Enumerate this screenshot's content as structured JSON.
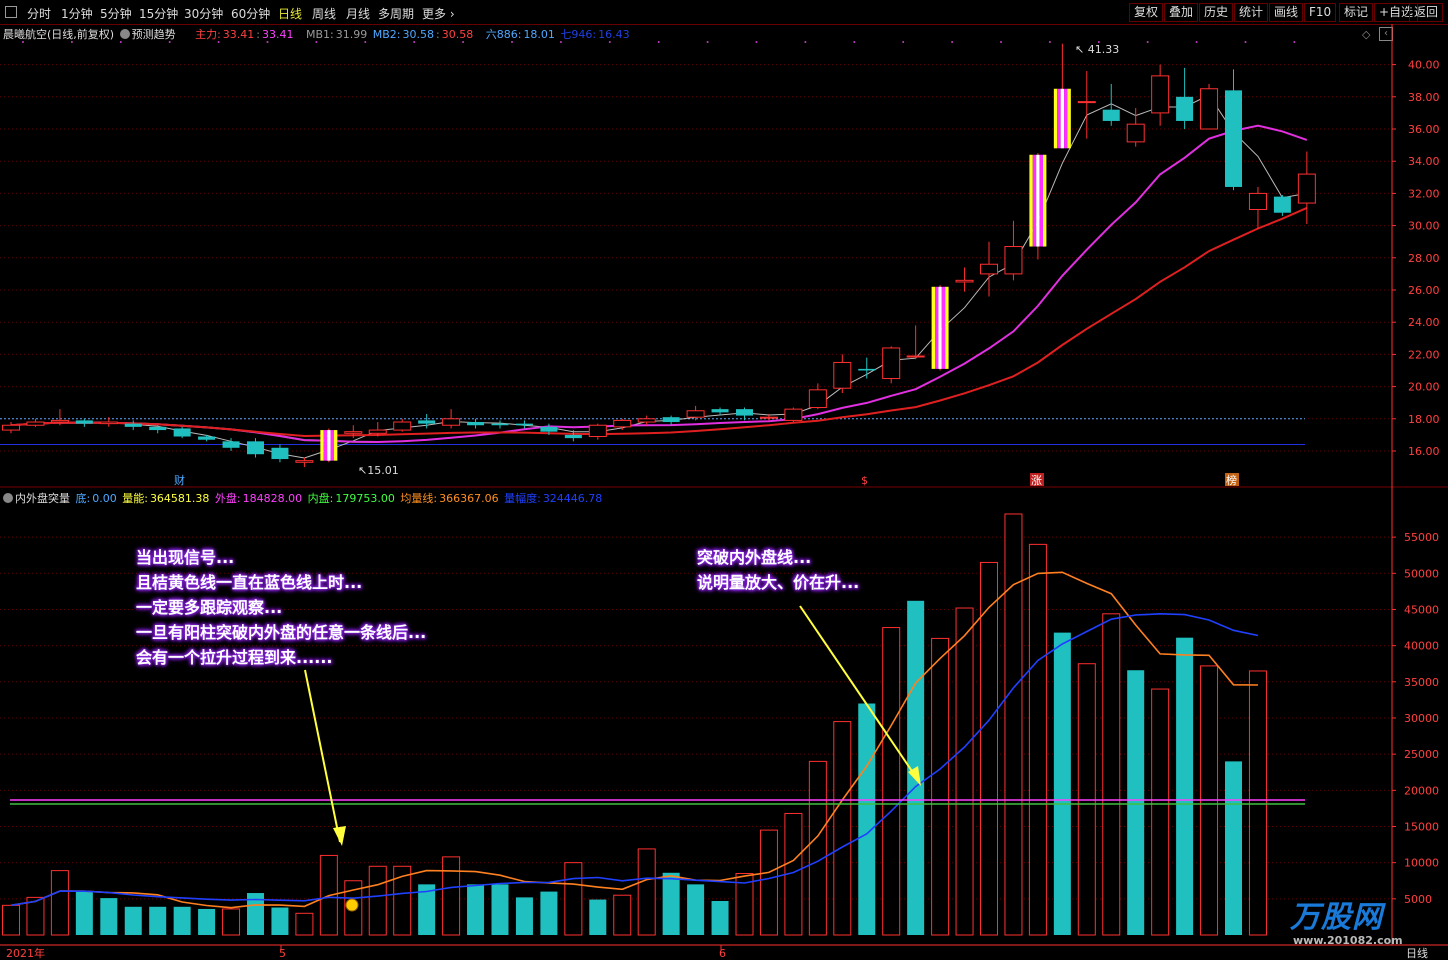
{
  "toolbar": {
    "tabs": [
      {
        "label": "分时",
        "active": false
      },
      {
        "label": "1分钟",
        "active": false
      },
      {
        "label": "5分钟",
        "active": false
      },
      {
        "label": "15分钟",
        "active": false
      },
      {
        "label": "30分钟",
        "active": false
      },
      {
        "label": "60分钟",
        "active": false
      },
      {
        "label": "日线",
        "active": true
      },
      {
        "label": "周线",
        "active": false
      },
      {
        "label": "月线",
        "active": false
      },
      {
        "label": "多周期",
        "active": false
      },
      {
        "label": "更多",
        "active": false
      }
    ],
    "buttons": [
      "复权",
      "叠加",
      "历史",
      "统计",
      "画线",
      "F10",
      "标记",
      "+自选",
      "返回"
    ]
  },
  "main_legend": {
    "stock_name": "晨曦航空(日线,前复权)",
    "forecast": "预测趋势",
    "main_label": "主力:",
    "main_value": "33.41",
    "main_value2": "33.41",
    "mb1_label": "MB1:",
    "mb1_value": "31.99",
    "mb2_label": "MB2:",
    "mb2_value": "30.58",
    "mb2_value2": "30.58",
    "six_label": "六886:",
    "six_value": "18.01",
    "seven_label": "七946:",
    "seven_value": "16.43"
  },
  "lower_legend": {
    "name": "内外盘突量",
    "di_label": "底:",
    "di_value": "0.00",
    "lianeng_label": "量能:",
    "lianeng_value": "364581.38",
    "waipan_label": "外盘:",
    "waipan_value": "184828.00",
    "neipan_label": "内盘:",
    "neipan_value": "179753.00",
    "junliang_label": "均量线:",
    "junliang_value": "366367.06",
    "liangfu_label": "量幅度:",
    "liangfu_value": "324446.78"
  },
  "callout_left": [
    "当出现信号...",
    "且桔黄色线一直在蓝色线上时...",
    "一定要多跟踪观察...",
    "一旦有阳柱突破内外盘的任意一条线后...",
    "会有一个拉升过程到来......"
  ],
  "callout_right": [
    "突破内外盘线...",
    "说明量放大、价在升..."
  ],
  "markers": {
    "cai": "财",
    "dollar": "$",
    "zhang": "涨",
    "bang": "榜"
  },
  "annotations": {
    "high": "41.33",
    "low": "15.01"
  },
  "xaxis": {
    "year": "2021年",
    "m5": "5",
    "m6": "6",
    "period": "日线"
  },
  "watermark": {
    "brand": "万股网",
    "url": "www.201082.com"
  },
  "colors": {
    "up": "#ff3030",
    "down": "#20c0c0",
    "grid": "#600000",
    "axis": "#ff3030"
  },
  "chart_data": {
    "type": "candlestick",
    "price_axis": {
      "ticks": [
        16,
        18,
        20,
        22,
        24,
        26,
        28,
        30,
        32,
        34,
        36,
        38,
        40
      ]
    },
    "volume_axis": {
      "ticks": [
        5000,
        10000,
        15000,
        20000,
        25000,
        30000,
        35000,
        40000,
        45000,
        50000,
        55000
      ]
    },
    "candles": [
      {
        "o": 17.3,
        "c": 17.6,
        "h": 17.8,
        "l": 17.1
      },
      {
        "o": 17.6,
        "c": 17.8,
        "h": 18.0,
        "l": 17.5
      },
      {
        "o": 17.8,
        "c": 17.9,
        "h": 18.6,
        "l": 17.6
      },
      {
        "o": 17.9,
        "c": 17.7,
        "h": 18.0,
        "l": 17.5
      },
      {
        "o": 17.7,
        "c": 17.8,
        "h": 18.1,
        "l": 17.5
      },
      {
        "o": 17.7,
        "c": 17.5,
        "h": 17.9,
        "l": 17.3
      },
      {
        "o": 17.5,
        "c": 17.3,
        "h": 17.6,
        "l": 17.1
      },
      {
        "o": 17.4,
        "c": 16.9,
        "h": 17.5,
        "l": 16.8
      },
      {
        "o": 16.9,
        "c": 16.7,
        "h": 17.0,
        "l": 16.6
      },
      {
        "o": 16.6,
        "c": 16.2,
        "h": 16.8,
        "l": 16.0
      },
      {
        "o": 16.6,
        "c": 15.8,
        "h": 16.8,
        "l": 15.6
      },
      {
        "o": 16.2,
        "c": 15.5,
        "h": 16.4,
        "l": 15.3
      },
      {
        "o": 15.3,
        "c": 15.4,
        "h": 15.6,
        "l": 15.0
      },
      {
        "o": 15.4,
        "c": 17.3,
        "h": 17.4,
        "l": 15.3,
        "sig": true
      },
      {
        "o": 17.1,
        "c": 17.2,
        "h": 17.6,
        "l": 16.8
      },
      {
        "o": 17.1,
        "c": 17.3,
        "h": 17.8,
        "l": 16.9
      },
      {
        "o": 17.3,
        "c": 17.8,
        "h": 18.0,
        "l": 17.2
      },
      {
        "o": 17.9,
        "c": 17.7,
        "h": 18.3,
        "l": 17.4
      },
      {
        "o": 17.6,
        "c": 18.0,
        "h": 18.6,
        "l": 17.4
      },
      {
        "o": 17.8,
        "c": 17.6,
        "h": 18.0,
        "l": 17.4
      },
      {
        "o": 17.7,
        "c": 17.6,
        "h": 17.9,
        "l": 17.4
      },
      {
        "o": 17.7,
        "c": 17.6,
        "h": 17.9,
        "l": 17.4
      },
      {
        "o": 17.5,
        "c": 17.2,
        "h": 17.7,
        "l": 17.0
      },
      {
        "o": 17.0,
        "c": 16.8,
        "h": 17.3,
        "l": 16.6
      },
      {
        "o": 16.9,
        "c": 17.6,
        "h": 17.7,
        "l": 16.7
      },
      {
        "o": 17.5,
        "c": 17.9,
        "h": 18.0,
        "l": 17.3
      },
      {
        "o": 17.8,
        "c": 18.0,
        "h": 18.2,
        "l": 17.6
      },
      {
        "o": 18.1,
        "c": 17.8,
        "h": 18.2,
        "l": 17.6
      },
      {
        "o": 18.1,
        "c": 18.5,
        "h": 18.8,
        "l": 17.9
      },
      {
        "o": 18.6,
        "c": 18.4,
        "h": 18.7,
        "l": 18.2
      },
      {
        "o": 18.6,
        "c": 18.2,
        "h": 18.7,
        "l": 17.9
      },
      {
        "o": 18.1,
        "c": 18.1,
        "h": 18.3,
        "l": 17.9
      },
      {
        "o": 17.9,
        "c": 18.6,
        "h": 18.7,
        "l": 17.8
      },
      {
        "o": 18.7,
        "c": 19.8,
        "h": 20.2,
        "l": 18.6
      },
      {
        "o": 19.9,
        "c": 21.5,
        "h": 22.0,
        "l": 19.6
      },
      {
        "o": 21.1,
        "c": 21.0,
        "h": 21.8,
        "l": 20.5
      },
      {
        "o": 20.5,
        "c": 22.4,
        "h": 22.5,
        "l": 20.2
      },
      {
        "o": 21.9,
        "c": 21.9,
        "h": 23.8,
        "l": 21.7
      },
      {
        "o": 21.1,
        "c": 26.2,
        "h": 26.3,
        "l": 21.0,
        "sig": true
      },
      {
        "o": 26.5,
        "c": 26.6,
        "h": 27.4,
        "l": 25.9
      },
      {
        "o": 27.0,
        "c": 27.6,
        "h": 29.0,
        "l": 25.6
      },
      {
        "o": 27.0,
        "c": 28.7,
        "h": 30.3,
        "l": 26.6
      },
      {
        "o": 28.7,
        "c": 34.4,
        "h": 34.5,
        "l": 27.9,
        "sig": true
      },
      {
        "o": 34.8,
        "c": 38.5,
        "h": 41.3,
        "l": 34.8,
        "sig": true
      },
      {
        "o": 37.7,
        "c": 37.7,
        "h": 39.6,
        "l": 35.4
      },
      {
        "o": 37.2,
        "c": 36.5,
        "h": 38.8,
        "l": 36.2
      },
      {
        "o": 35.2,
        "c": 36.3,
        "h": 37.3,
        "l": 34.9
      },
      {
        "o": 37.0,
        "c": 39.3,
        "h": 40.0,
        "l": 36.2
      },
      {
        "o": 38.0,
        "c": 36.5,
        "h": 39.8,
        "l": 36.0
      },
      {
        "o": 36.0,
        "c": 38.5,
        "h": 38.8,
        "l": 36.0
      },
      {
        "o": 38.4,
        "c": 32.4,
        "h": 39.7,
        "l": 32.2
      },
      {
        "o": 31.0,
        "c": 32.0,
        "h": 32.4,
        "l": 29.8
      },
      {
        "o": 31.8,
        "c": 30.8,
        "h": 31.9,
        "l": 30.6
      },
      {
        "o": 31.4,
        "c": 33.2,
        "h": 34.6,
        "l": 30.1
      }
    ],
    "volume": [
      {
        "v": 4100,
        "up": true
      },
      {
        "v": 5200,
        "up": true
      },
      {
        "v": 8900,
        "up": true
      },
      {
        "v": 6000,
        "up": false
      },
      {
        "v": 5100,
        "up": false
      },
      {
        "v": 3900,
        "up": false
      },
      {
        "v": 3900,
        "up": false
      },
      {
        "v": 3900,
        "up": false
      },
      {
        "v": 3600,
        "up": false
      },
      {
        "v": 3600,
        "up": true
      },
      {
        "v": 5800,
        "up": false
      },
      {
        "v": 3800,
        "up": false
      },
      {
        "v": 3000,
        "up": true
      },
      {
        "v": 11000,
        "up": true
      },
      {
        "v": 7500,
        "up": true
      },
      {
        "v": 9500,
        "up": true
      },
      {
        "v": 9500,
        "up": true
      },
      {
        "v": 7000,
        "up": false
      },
      {
        "v": 10800,
        "up": true
      },
      {
        "v": 7000,
        "up": false
      },
      {
        "v": 7000,
        "up": false
      },
      {
        "v": 5200,
        "up": false
      },
      {
        "v": 6000,
        "up": false
      },
      {
        "v": 10000,
        "up": true
      },
      {
        "v": 4900,
        "up": false
      },
      {
        "v": 5500,
        "up": true
      },
      {
        "v": 11900,
        "up": true
      },
      {
        "v": 8600,
        "up": false
      },
      {
        "v": 7000,
        "up": false
      },
      {
        "v": 4700,
        "up": false
      },
      {
        "v": 8500,
        "up": true
      },
      {
        "v": 14500,
        "up": true
      },
      {
        "v": 16800,
        "up": true
      },
      {
        "v": 24000,
        "up": true
      },
      {
        "v": 29500,
        "up": true
      },
      {
        "v": 32000,
        "up": false
      },
      {
        "v": 42500,
        "up": true
      },
      {
        "v": 46200,
        "up": false
      },
      {
        "v": 41000,
        "up": true
      },
      {
        "v": 45200,
        "up": true
      },
      {
        "v": 51500,
        "up": true
      },
      {
        "v": 58200,
        "up": true
      },
      {
        "v": 54000,
        "up": true
      },
      {
        "v": 41800,
        "up": false
      },
      {
        "v": 37500,
        "up": true
      },
      {
        "v": 44400,
        "up": true
      },
      {
        "v": 36600,
        "up": false
      },
      {
        "v": 34000,
        "up": true
      },
      {
        "v": 41100,
        "up": false
      },
      {
        "v": 37200,
        "up": true
      },
      {
        "v": 24000,
        "up": false
      },
      {
        "v": 36500,
        "up": true
      }
    ],
    "hlines": [
      18.0,
      16.4
    ]
  }
}
